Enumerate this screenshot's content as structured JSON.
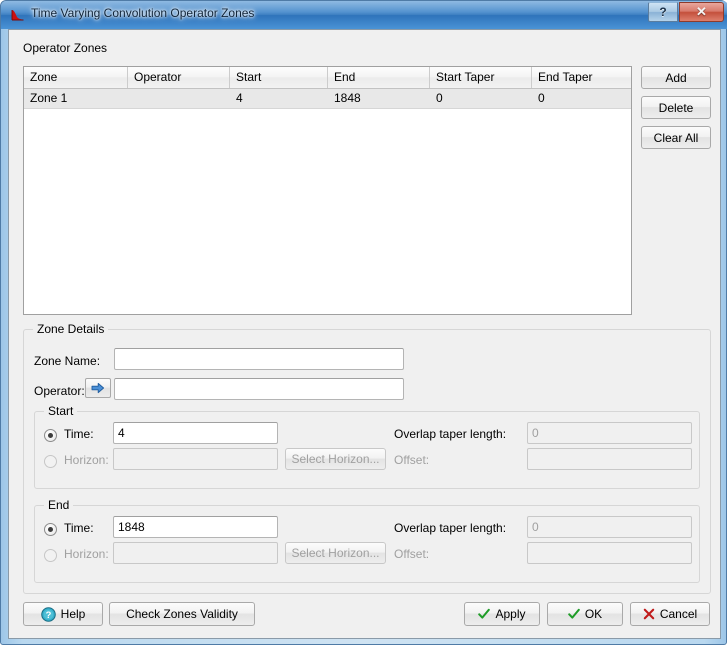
{
  "window": {
    "title": "Time Varying Convolution Operator Zones",
    "icon": "red-curve-chart-icon",
    "help_button_glyph": "?",
    "close_button_glyph": "✕",
    "accent_titlebar": "#3c83c8",
    "close_button_color": "#c4503c"
  },
  "operator_zones": {
    "section_label": "Operator Zones",
    "columns": [
      "Zone",
      "Operator",
      "Start",
      "End",
      "Start Taper",
      "End Taper"
    ],
    "rows": [
      {
        "zone": "Zone 1",
        "operator": "",
        "start": "4",
        "end": "1848",
        "start_taper": "0",
        "end_taper": "0",
        "selected": true
      }
    ],
    "side_buttons": [
      {
        "label": "Add",
        "name": "add-button"
      },
      {
        "label": "Delete",
        "name": "delete-button"
      },
      {
        "label": "Clear All",
        "name": "clear-all-button"
      }
    ]
  },
  "zone_details": {
    "section_label": "Zone Details",
    "zone_name": {
      "label": "Zone Name:",
      "value": "",
      "placeholder": ""
    },
    "operator": {
      "label": "Operator:",
      "value": "",
      "placeholder": "",
      "browse_icon": "arrow-right-icon"
    },
    "start": {
      "group_label": "Start",
      "time_label": "Time:",
      "time_value": "4",
      "time_selected": true,
      "horizon_label": "Horizon:",
      "horizon_value": "",
      "horizon_selected": false,
      "horizon_enabled": false,
      "select_horizon_label": "Select Horizon...",
      "select_horizon_enabled": false,
      "overlap_label": "Overlap taper length:",
      "overlap_value": "0",
      "overlap_enabled": false,
      "offset_label": "Offset:",
      "offset_value": "",
      "offset_enabled": false
    },
    "end": {
      "group_label": "End",
      "time_label": "Time:",
      "time_value": "1848",
      "time_selected": true,
      "horizon_label": "Horizon:",
      "horizon_value": "",
      "horizon_selected": false,
      "horizon_enabled": false,
      "select_horizon_label": "Select Horizon...",
      "select_horizon_enabled": false,
      "overlap_label": "Overlap taper length:",
      "overlap_value": "0",
      "overlap_enabled": false,
      "offset_label": "Offset:",
      "offset_value": "",
      "offset_enabled": false
    }
  },
  "footer": {
    "help_label": "Help",
    "help_icon": "question-circle-icon",
    "check_validity_label": "Check Zones Validity",
    "apply_label": "Apply",
    "apply_icon": "check-icon",
    "ok_label": "OK",
    "ok_icon": "check-icon",
    "cancel_label": "Cancel",
    "cancel_icon": "x-icon",
    "check_color": "#1f9c28",
    "cancel_color": "#c01b1b",
    "help_icon_color": "#2fa6c4"
  }
}
